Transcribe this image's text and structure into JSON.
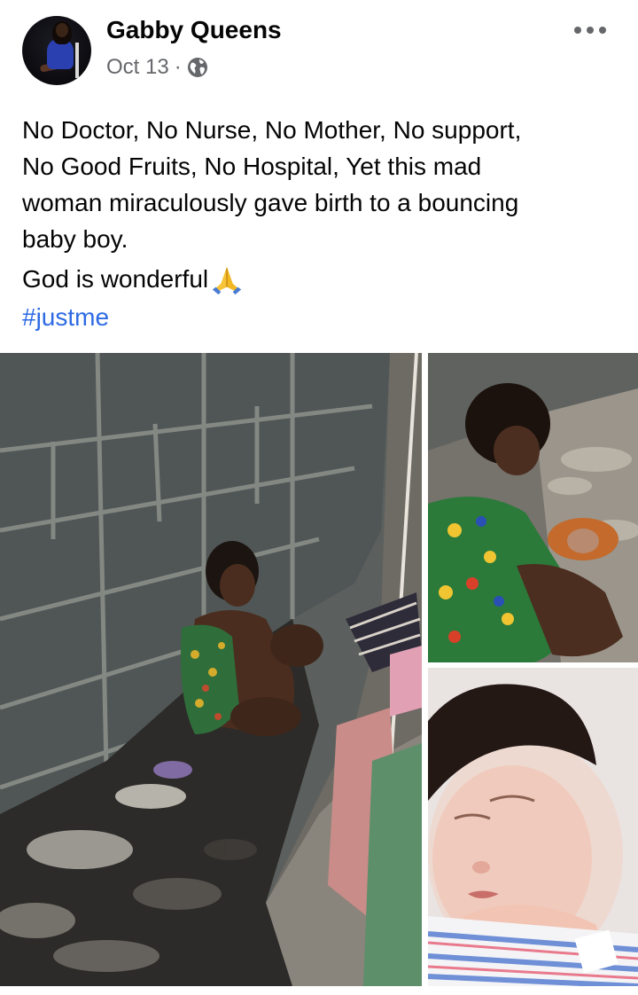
{
  "post": {
    "author": "Gabby Queens",
    "date": "Oct 13",
    "separator": "·",
    "privacy_icon": "globe-icon",
    "menu_icon": "more-options-icon",
    "text_lines": [
      "No Doctor, No Nurse, No Mother, No support,",
      "No Good Fruits, No Hospital, Yet this mad",
      "woman miraculously gave birth to a bouncing",
      "baby boy."
    ],
    "closing_line": "God is wonderful",
    "closing_emoji": "folded-hands-icon",
    "hashtag": "#justme"
  },
  "photos": [
    {
      "name": "woman-against-wall-photo"
    },
    {
      "name": "woman-with-baby-photo"
    },
    {
      "name": "newborn-baby-photo"
    }
  ],
  "colors": {
    "text": "#050505",
    "secondary_text": "#65676b",
    "link": "#2d6ae4",
    "background": "#ffffff"
  }
}
